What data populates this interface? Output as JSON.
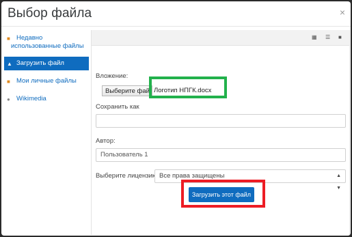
{
  "dialog": {
    "title": "Выбор файла",
    "close_glyph": "×"
  },
  "sidebar": {
    "items": [
      {
        "label": "Недавно использованные файлы",
        "icon": "folder-icon"
      },
      {
        "label": "Загрузить файл",
        "icon": "upload-icon",
        "active": true
      },
      {
        "label": "Мои личные файлы",
        "icon": "folder-icon"
      },
      {
        "label": "Wikimedia",
        "icon": "globe-icon"
      }
    ]
  },
  "toolbar": {
    "views": [
      "grid-view-icon",
      "list-view-icon",
      "folder-view-icon"
    ]
  },
  "form": {
    "attachment_label": "Вложение:",
    "choose_button": "Выберите файл",
    "filename": "Логотип НПГК.docx",
    "save_as_label": "Сохранить как",
    "save_as_value": "",
    "author_label": "Автор:",
    "author_value": "Пользователь 1",
    "license_label": "Выберите лицензию",
    "license_value": "Все права защищены",
    "upload_button": "Загрузить этот файл"
  },
  "colors": {
    "accent": "#0f6cbf",
    "highlight_green": "#22b14c",
    "highlight_red": "#ed1c24"
  }
}
